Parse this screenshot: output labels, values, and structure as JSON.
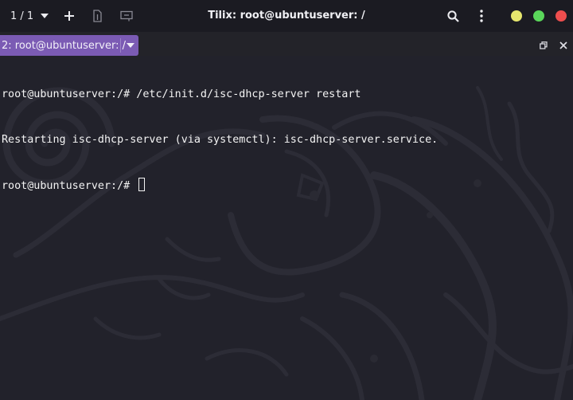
{
  "header": {
    "session_counter": "1 / 1",
    "title": "Tilix: root@ubuntuserver: /",
    "icons": {
      "session_menu": "chevron-down-icon",
      "add": "plus-icon",
      "split_vertical": "split-vertical-icon",
      "split_horizontal": "split-horizontal-icon",
      "search": "search-icon",
      "menu": "kebab-menu-icon"
    },
    "window_controls": {
      "minimize_color": "#e6e66e",
      "maximize_color": "#5ad65a",
      "close_color": "#ee4e4e"
    }
  },
  "terminal_tab": {
    "label": "2: root@ubuntuserver: /",
    "accent": "#7b5bb4",
    "icons": {
      "dropdown": "chevron-down-icon",
      "maximize": "maximize-icon",
      "close": "close-icon"
    }
  },
  "terminal": {
    "lines": [
      "root@ubuntuserver:/# /etc/init.d/isc-dhcp-server restart",
      "Restarting isc-dhcp-server (via systemctl): isc-dhcp-server.service.",
      "root@ubuntuserver:/# "
    ],
    "background": "#22222b",
    "foreground": "#f4f4f4"
  }
}
